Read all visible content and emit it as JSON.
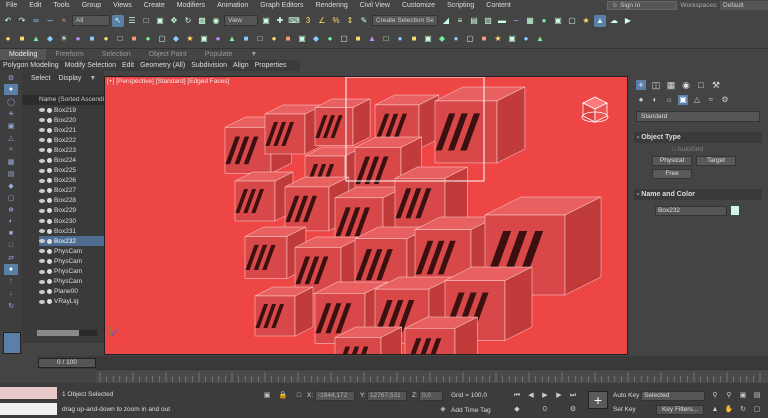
{
  "menu": {
    "items": [
      "File",
      "Edit",
      "Tools",
      "Group",
      "Views",
      "Create",
      "Modifiers",
      "Animation",
      "Graph Editors",
      "Rendering",
      "Civil View",
      "Customize",
      "Scripting",
      "Content"
    ],
    "sign_in": "Sign In",
    "workspaces_label": "Workspaces:",
    "workspaces_value": "Default"
  },
  "toolbar": {
    "filter_dropdown": "All",
    "view_dropdown": "View",
    "selection_set": "Create Selection Se"
  },
  "ribbon": {
    "tabs": [
      "Modeling",
      "Freeform",
      "Selection",
      "Object Paint",
      "Populate"
    ],
    "subtabs": [
      "Polygon Modeling",
      "Modify Selection",
      "Edit",
      "Geometry (All)",
      "Subdivision",
      "Align",
      "Properties"
    ]
  },
  "scene_explorer": {
    "tabs": [
      "Select",
      "Display"
    ],
    "header": "Name (Sorted Ascending)",
    "items": [
      "Box219",
      "Box220",
      "Box221",
      "Box222",
      "Box223",
      "Box224",
      "Box225",
      "Box226",
      "Box227",
      "Box228",
      "Box229",
      "Box230",
      "Box231",
      "Box232",
      "PhysCam",
      "PhysCam",
      "PhysCam",
      "PhysCam",
      "Plane00",
      "VRayLig"
    ],
    "selected_index": 13
  },
  "viewport": {
    "label": "[+] [Perspective] [Standard] [Edged Faces]",
    "background": "#ee4545"
  },
  "command_panel": {
    "dropdown": "Standard",
    "object_type_title": "Object Type",
    "autogrid": "AutoGrid",
    "buttons": [
      "Physical",
      "Target",
      "Free"
    ],
    "name_color_title": "Name and Color",
    "object_name": "Box232",
    "object_color": "#ccf5f0"
  },
  "timeline": {
    "slider": "0 / 100"
  },
  "status": {
    "selected": "1 Object Selected",
    "prompt": "drag up-and-down to zoom in and out",
    "x_label": "X:",
    "x_value": "-1944,172",
    "y_label": "Y:",
    "y_value": "12767,531",
    "z_label": "Z:",
    "z_value": "0,0",
    "grid": "Grid = 100,0",
    "add_time_tag": "Add Time Tag",
    "auto_key": "Auto Key",
    "selected_dropdown": "Selected",
    "set_key": "Set Key",
    "key_filters": "Key Filters..."
  }
}
